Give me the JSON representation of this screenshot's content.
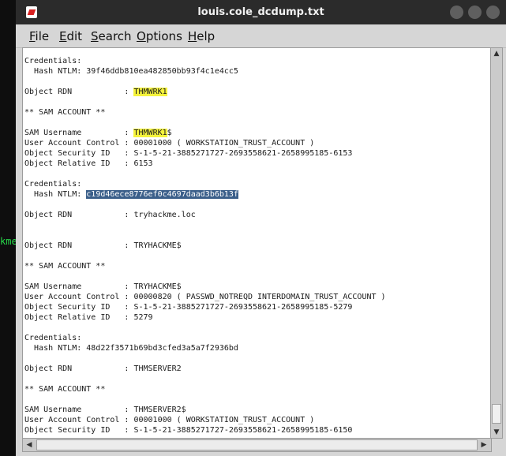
{
  "background_terminal": {
    "fragment": "kme,",
    "text_color": "#27d84a"
  },
  "window": {
    "title": "louis.cole_dcdump.txt",
    "highlight_color": "#f5f33c",
    "selection_color": "#3b5f8a"
  },
  "menu": [
    {
      "underline": "F",
      "rest": "ile"
    },
    {
      "underline": "E",
      "rest": "dit"
    },
    {
      "underline": "S",
      "rest": "earch"
    },
    {
      "underline": "O",
      "rest": "ptions"
    },
    {
      "underline": "H",
      "rest": "elp"
    }
  ],
  "content": {
    "l1": "Credentials:",
    "l2": "  Hash NTLM: 39f46ddb810ea482850bb93f4c1e4cc5",
    "l3_label": "Object RDN           : ",
    "l3_hl": "THMWRK1",
    "l4": "** SAM ACCOUNT **",
    "l5_label": "SAM Username         : ",
    "l5_hl": "THMWRK1",
    "l5_tail": "$",
    "l6": "User Account Control : 00001000 ( WORKSTATION_TRUST_ACCOUNT )",
    "l7": "Object Security ID   : S-1-5-21-3885271727-2693558621-2658995185-6153",
    "l8": "Object Relative ID   : 6153",
    "l9": "Credentials:",
    "l10_label": "  Hash NTLM: ",
    "l10_sel": "c19d46ece8776ef0c4697daad3b6b13f",
    "l11": "Object RDN           : tryhackme.loc",
    "l12": "Object RDN           : TRYHACKME$",
    "l13": "** SAM ACCOUNT **",
    "l14": "SAM Username         : TRYHACKME$",
    "l15": "User Account Control : 00000820 ( PASSWD_NOTREQD INTERDOMAIN_TRUST_ACCOUNT )",
    "l16": "Object Security ID   : S-1-5-21-3885271727-2693558621-2658995185-5279",
    "l17": "Object Relative ID   : 5279",
    "l18": "Credentials:",
    "l19": "  Hash NTLM: 48d22f3571b69bd3cfed3a5a7f2936bd",
    "l20": "Object RDN           : THMSERVER2",
    "l21": "** SAM ACCOUNT **",
    "l22": "SAM Username         : THMSERVER2$",
    "l23": "User Account Control : 00001000 ( WORKSTATION_TRUST_ACCOUNT )",
    "l24": "Object Security ID   : S-1-5-21-3885271727-2693558621-2658995185-6150"
  }
}
